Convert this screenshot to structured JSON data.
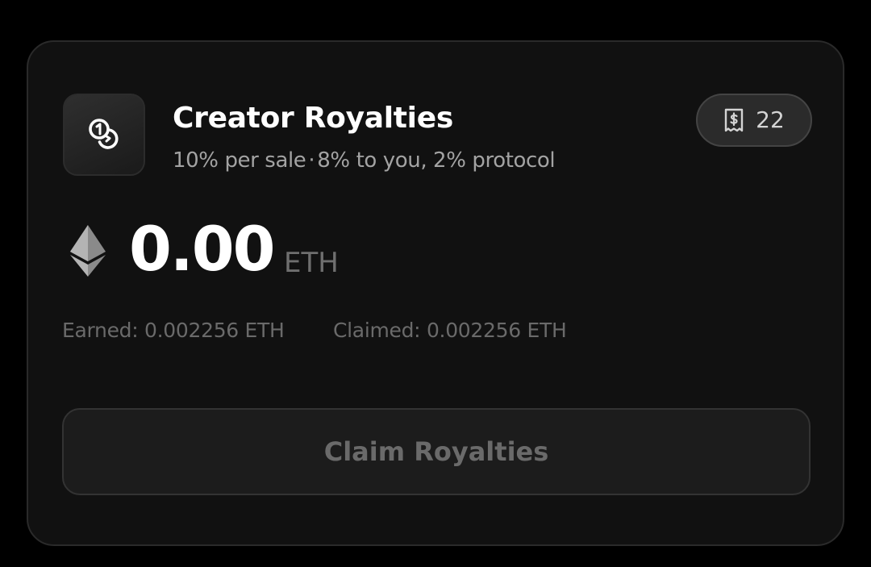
{
  "card": {
    "title": "Creator Royalties",
    "subtitle": {
      "rate": "10% per sale",
      "separator": "·",
      "split": "8% to you, 2% protocol"
    },
    "icon": "coins-icon",
    "badge": {
      "icon": "receipt-dollar-icon",
      "count": "22"
    }
  },
  "balance": {
    "icon": "ethereum-icon",
    "amount": "0.00",
    "unit": "ETH"
  },
  "stats": {
    "earned": "Earned: 0.002256 ETH",
    "claimed": "Claimed: 0.002256 ETH"
  },
  "action": {
    "claim_label": "Claim Royalties",
    "disabled": true
  },
  "colors": {
    "page_background": "#000000",
    "card_background": "#111111",
    "primary_text": "#ffffff",
    "muted_text": "#6a6a6a",
    "button_background": "#1c1c1c"
  }
}
